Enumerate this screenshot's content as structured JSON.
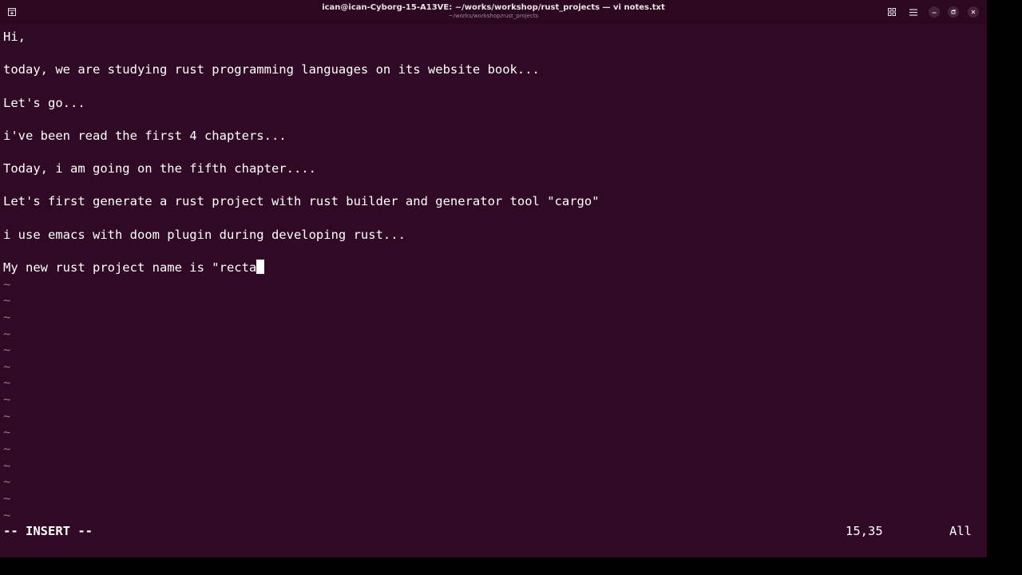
{
  "window": {
    "title": "ican@ican-Cyborg-15-A13VE: ~/works/workshop/rust_projects — vi notes.txt",
    "subtitle": "~/works/workshop/rust_projects"
  },
  "titlebar_icons": {
    "new_tab": "new-tab-icon",
    "grid": "grid-view-icon",
    "menu": "hamburger-menu-icon",
    "minimize": "minimize-icon",
    "maximize": "maximize-icon",
    "close": "close-icon"
  },
  "editor": {
    "lines": [
      "Hi,",
      "",
      "today, we are studying rust programming languages on its website book...",
      "",
      "Let's go...",
      "",
      "i've been read the first 4 chapters...",
      "",
      "Today, i am going on the fifth chapter....",
      "",
      "Let's first generate a rust project with rust builder and generator tool \"cargo\"",
      "",
      "i use emacs with doom plugin during developing rust...",
      "",
      "My new rust project name is \"recta"
    ],
    "empty_marker": "~",
    "empty_line_count": 15
  },
  "status": {
    "mode": "-- INSERT --",
    "position": "15,35",
    "scroll": "All"
  },
  "colors": {
    "background": "#300a24",
    "foreground": "#ffffff",
    "titlebar": "#2b0720"
  }
}
